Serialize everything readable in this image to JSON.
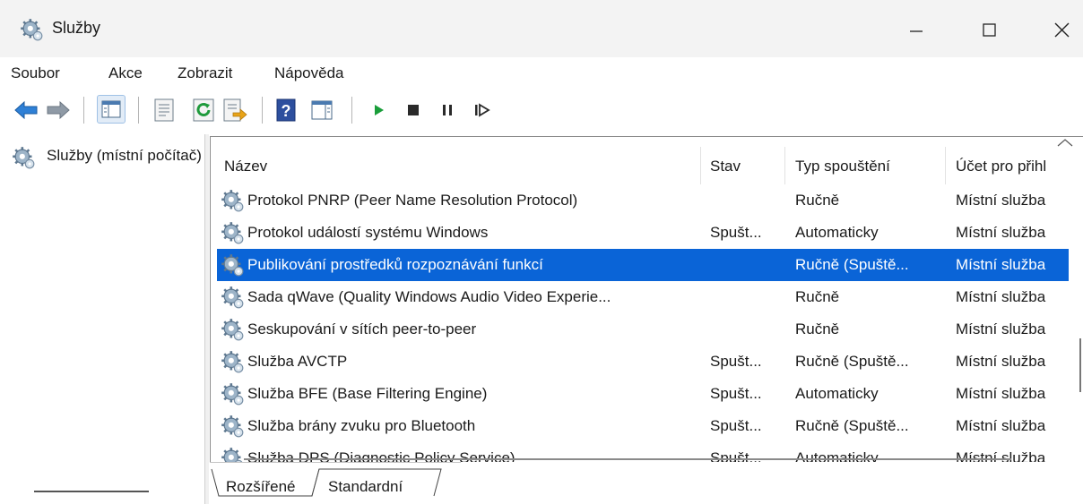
{
  "window": {
    "title": "Služby",
    "controls": {
      "minimize": "minimize-icon",
      "maximize": "maximize-icon",
      "close": "close-icon"
    }
  },
  "menu": [
    "Soubor",
    "Akce",
    "Zobrazit",
    "Nápověda"
  ],
  "toolbar": {
    "buttons": [
      "back-arrow-icon",
      "forward-arrow-icon",
      "show-hide-console-tree-icon",
      "properties-icon",
      "refresh-icon",
      "export-list-icon",
      "help-icon",
      "show-hide-action-pane-icon",
      "start-service-icon",
      "stop-service-icon",
      "pause-service-icon",
      "resume-service-icon"
    ]
  },
  "tree": {
    "root_label": "Služby (místní počítač)"
  },
  "table": {
    "columns": [
      "Název",
      "Stav",
      "Typ spouštění",
      "Účet pro přihl"
    ],
    "rows": [
      {
        "name": "Protokol PNRP (Peer Name Resolution Protocol)",
        "status": "",
        "startup": "Ručně",
        "account": "Místní služba"
      },
      {
        "name": "Protokol událostí systému Windows",
        "status": "Spušt...",
        "startup": "Automaticky",
        "account": "Místní služba"
      },
      {
        "name": "Publikování prostředků rozpoznávání funkcí",
        "status": "",
        "startup": "Ručně (Spuště...",
        "account": "Místní služba",
        "selected": true
      },
      {
        "name": "Sada qWave (Quality Windows Audio Video Experie...",
        "status": "",
        "startup": "Ručně",
        "account": "Místní služba"
      },
      {
        "name": "Seskupování v sítích peer-to-peer",
        "status": "",
        "startup": "Ručně",
        "account": "Místní služba"
      },
      {
        "name": "Služba AVCTP",
        "status": "Spušt...",
        "startup": "Ručně (Spuště...",
        "account": "Místní služba"
      },
      {
        "name": "Služba BFE (Base Filtering Engine)",
        "status": "Spušt...",
        "startup": "Automaticky",
        "account": "Místní služba"
      },
      {
        "name": "Služba brány zvuku pro Bluetooth",
        "status": "Spušt...",
        "startup": "Ručně (Spuště...",
        "account": "Místní služba"
      },
      {
        "name": "Služba DPS (Diagnostic Policy Service)",
        "status": "Spušt...",
        "startup": "Automaticky",
        "account": "Místní služba"
      }
    ]
  },
  "tabs": [
    "Rozšířené",
    "Standardní"
  ],
  "active_tab": "Standardní",
  "colors": {
    "selection": "#0a64d7",
    "titlebar": "#f3f3f3",
    "play": "#1a9e3a"
  }
}
